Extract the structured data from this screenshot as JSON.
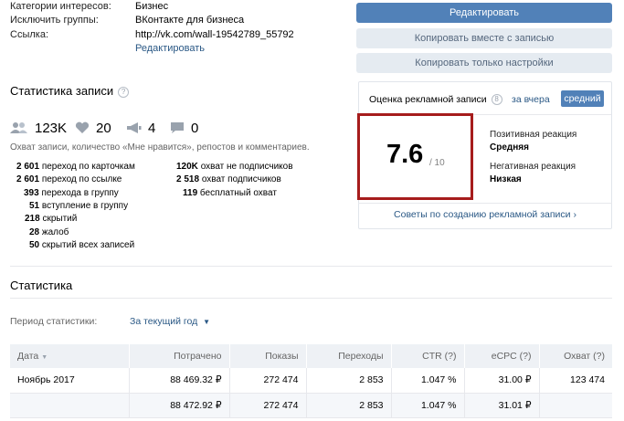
{
  "post_info": {
    "rows": [
      {
        "key": "Категории интересов:",
        "value": "Бизнес"
      },
      {
        "key": "Исключить группы:",
        "value": "ВКонтакте для бизнеса"
      },
      {
        "key": "Ссылка:",
        "value": "http://vk.com/wall-19542789_55792"
      }
    ],
    "edit_link": "Редактировать"
  },
  "actions": {
    "edit": "Редактировать",
    "copy_with_post": "Копировать вместе с записью",
    "copy_settings": "Копировать только настройки"
  },
  "post_stats": {
    "title": "Статистика записи",
    "help": "?",
    "counters": {
      "reach": "123K",
      "likes": "20",
      "reposts": "4",
      "comments": "0"
    },
    "description": "Охват записи, количество «Мне нравится», репостов и комментариев.",
    "left": [
      {
        "num": "2 601",
        "text": "переход по карточкам"
      },
      {
        "num": "2 601",
        "text": "переход по ссылке"
      },
      {
        "num": "393",
        "text": "перехода в группу"
      },
      {
        "num": "51",
        "text": "вступление в группу"
      },
      {
        "num": "218",
        "text": "скрытий"
      },
      {
        "num": "28",
        "text": "жалоб"
      },
      {
        "num": "50",
        "text": "скрытий всех записей"
      }
    ],
    "right": [
      {
        "num": "120K",
        "text": "охват не подписчиков"
      },
      {
        "num": "2 518",
        "text": "охват подписчиков"
      },
      {
        "num": "119",
        "text": "бесплатный охват"
      }
    ]
  },
  "rating": {
    "title": "Оценка рекламной записи",
    "info": "8",
    "tab_yesterday": "за вчера",
    "tab_average": "средний",
    "score": "7.6",
    "denominator": "/ 10",
    "positive_label": "Позитивная реакция",
    "positive_value": "Средняя",
    "negative_label": "Негативная реакция",
    "negative_value": "Низкая",
    "tips": "Советы по созданию рекламной записи ›"
  },
  "stats": {
    "title": "Статистика",
    "period_label": "Период статистики:",
    "period_value": "За текущий год",
    "columns": [
      "Дата",
      "Потрачено",
      "Показы",
      "Переходы",
      "CTR (?)",
      "eCPC (?)",
      "Охват (?)"
    ],
    "rows": [
      [
        "Ноябрь 2017",
        "88 469.32 ₽",
        "272 474",
        "2 853",
        "1.047 %",
        "31.00 ₽",
        "123 474"
      ]
    ],
    "total": [
      "",
      "88 472.92 ₽",
      "272 474",
      "2 853",
      "1.047 %",
      "31.01 ₽",
      ""
    ]
  },
  "colors": {
    "accent": "#5181b8",
    "link": "#2a5885",
    "highlight": "#a61c1c"
  }
}
